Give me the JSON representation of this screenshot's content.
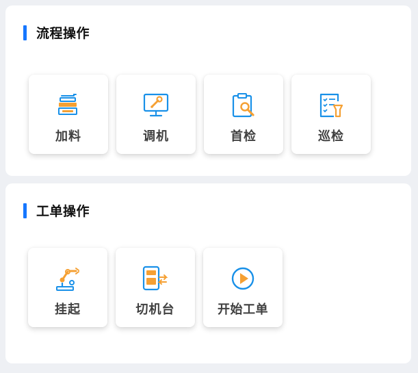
{
  "sections": [
    {
      "title": "流程操作",
      "items": [
        {
          "label": "加料",
          "icon": "feeder-icon"
        },
        {
          "label": "调机",
          "icon": "monitor-wrench-icon"
        },
        {
          "label": "首检",
          "icon": "clipboard-search-icon"
        },
        {
          "label": "巡检",
          "icon": "checklist-flashlight-icon"
        }
      ]
    },
    {
      "title": "工单操作",
      "items": [
        {
          "label": "挂起",
          "icon": "robot-arm-icon"
        },
        {
          "label": "切机台",
          "icon": "switch-machine-icon"
        },
        {
          "label": "开始工单",
          "icon": "play-circle-icon"
        }
      ]
    }
  ],
  "colors": {
    "accent": "#1677ff",
    "icon_blue": "#1890e8",
    "icon_orange": "#f5a033"
  }
}
